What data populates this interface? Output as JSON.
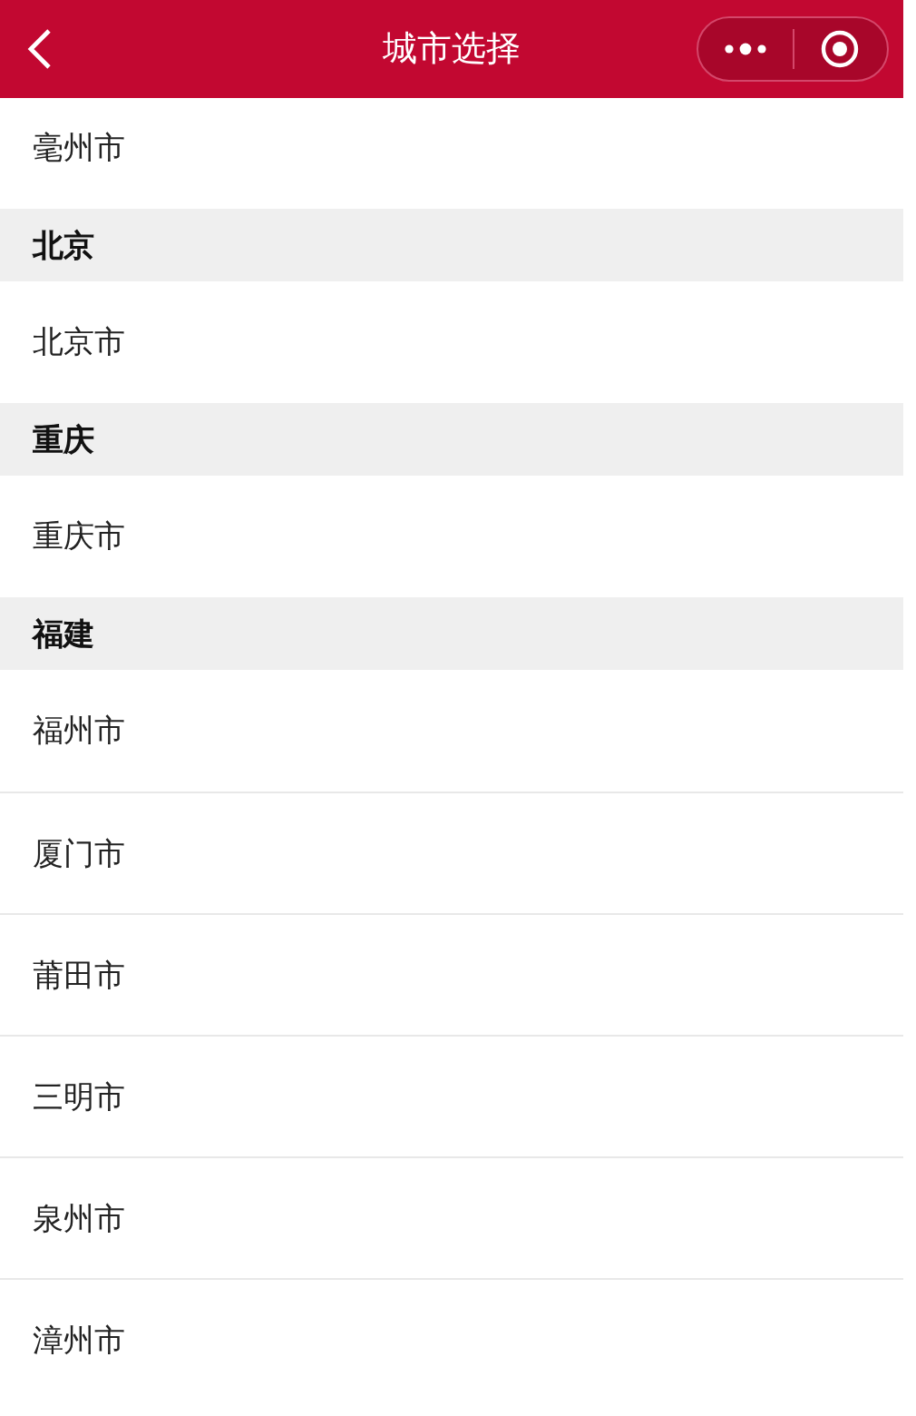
{
  "nav_bar": {
    "title": "城市选择"
  },
  "rows": [
    {
      "kind": "city",
      "label": "毫州市"
    },
    {
      "kind": "group",
      "label": "北京"
    },
    {
      "kind": "city",
      "label": "北京市"
    },
    {
      "kind": "group",
      "label": "重庆"
    },
    {
      "kind": "city",
      "label": "重庆市"
    },
    {
      "kind": "group",
      "label": "福建"
    },
    {
      "kind": "city",
      "label": "福州市"
    },
    {
      "kind": "city",
      "label": "厦门市"
    },
    {
      "kind": "city",
      "label": "莆田市"
    },
    {
      "kind": "city",
      "label": "三明市"
    },
    {
      "kind": "city",
      "label": "泉州市"
    },
    {
      "kind": "city",
      "label": "漳州市"
    }
  ]
}
